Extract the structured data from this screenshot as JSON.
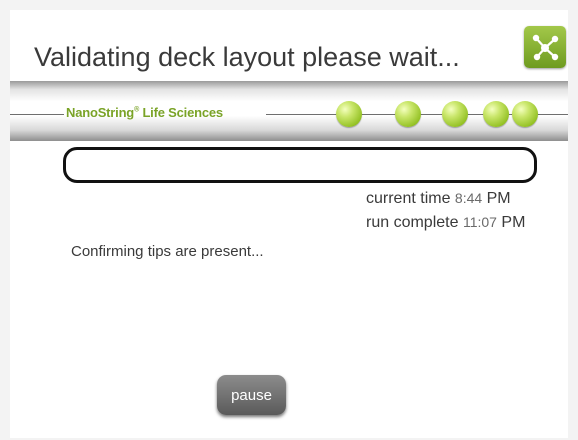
{
  "header": {
    "title": "Validating deck layout please wait..."
  },
  "app_icon": {
    "icon": "network-nodes-icon",
    "color": "#8dba2f"
  },
  "banner": {
    "brand_name": "NanoString",
    "brand_mark": "®",
    "brand_suffix": " Life Sciences",
    "brand_color": "#7aa327"
  },
  "progress": {
    "fraction": 0.0
  },
  "times": {
    "current_label": "current time",
    "current_value": "8:44",
    "current_suffix": "PM",
    "complete_label": "run complete",
    "complete_value": "11:07",
    "complete_suffix": "PM"
  },
  "status": {
    "message": "Confirming tips are present..."
  },
  "controls": {
    "pause_label": "pause"
  }
}
